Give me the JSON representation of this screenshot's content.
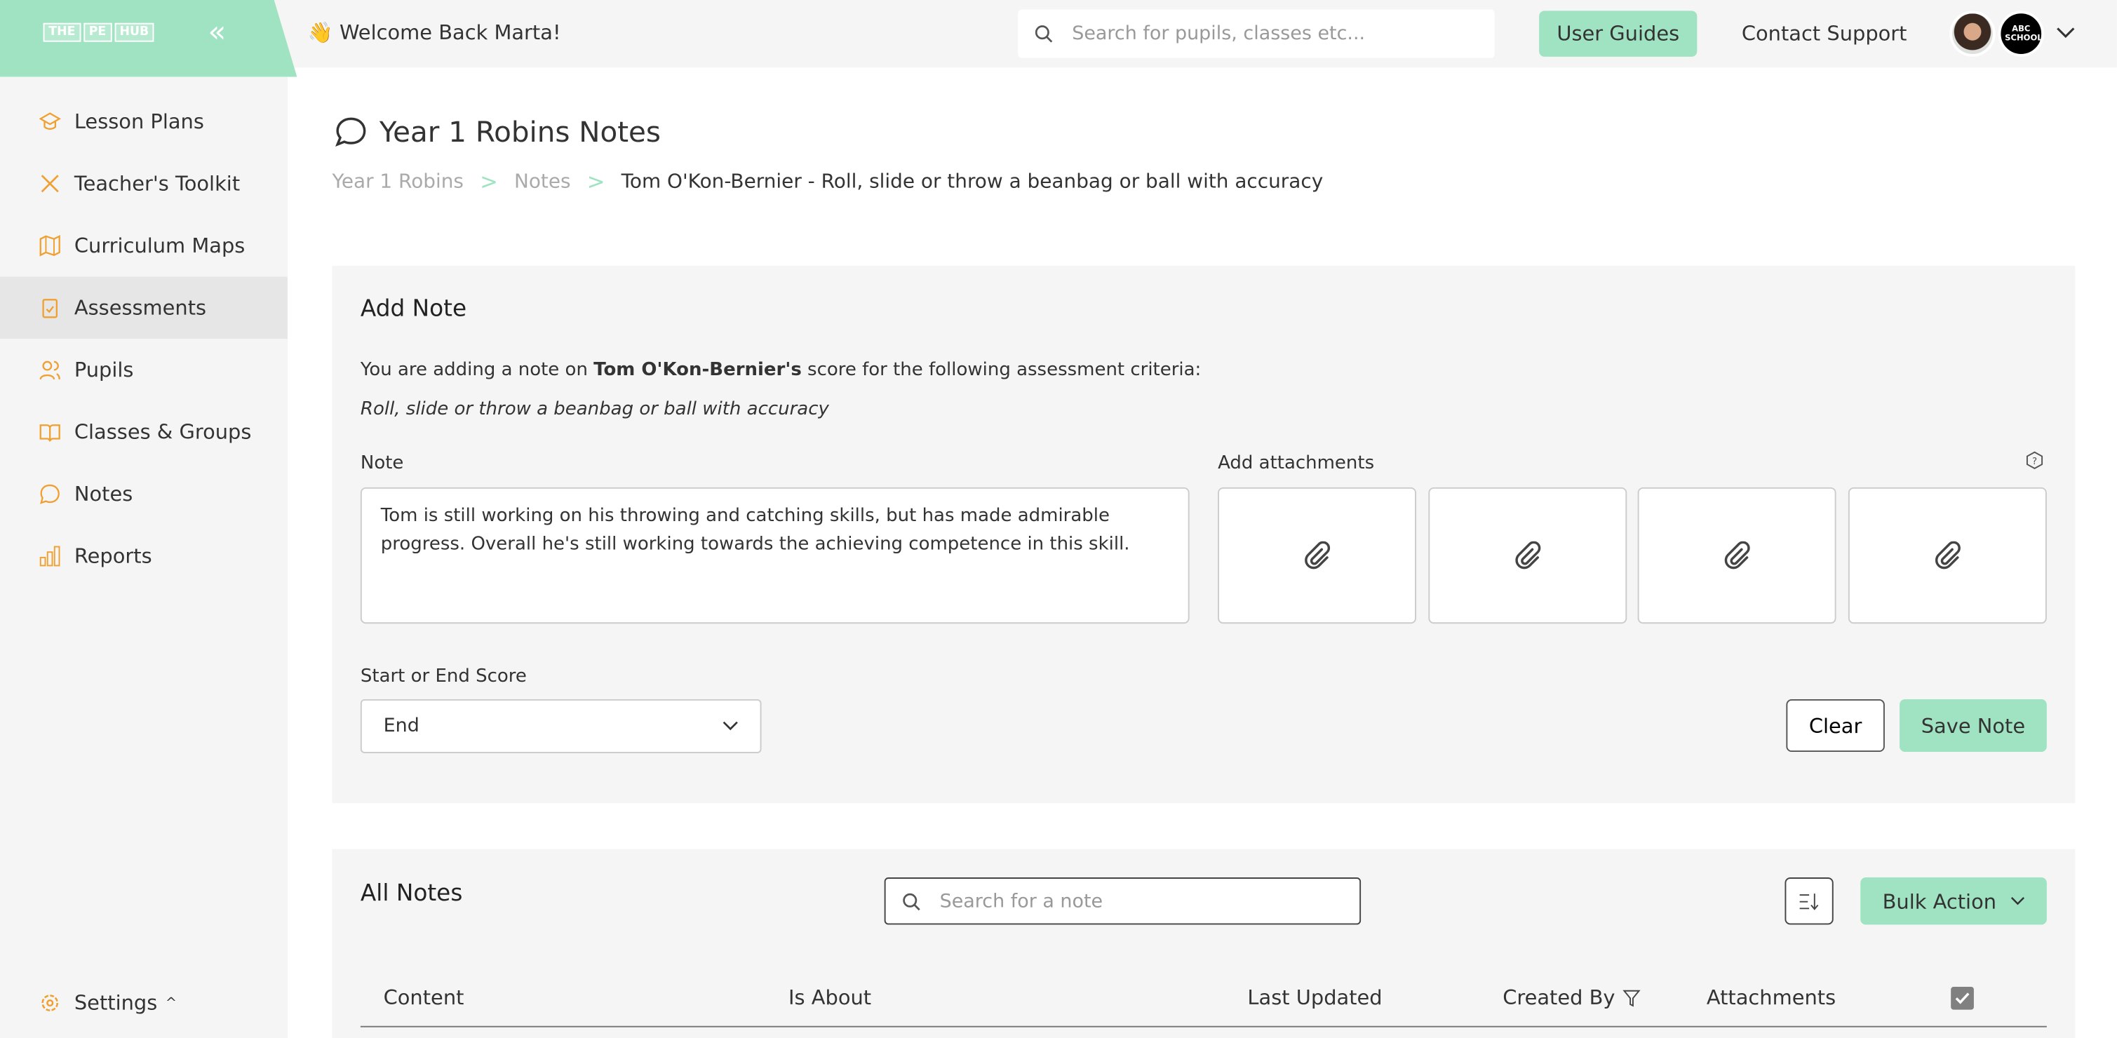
{
  "colors": {
    "accent": "#9fe3c2",
    "icon_orange": "#f0a030",
    "sidebar_bg": "#f5f5f5"
  },
  "logo": {
    "text": "THE PE HUB",
    "parts": [
      "THE",
      "PE",
      "HUB"
    ]
  },
  "header": {
    "welcome": "👋 Welcome Back Marta!",
    "search_placeholder": "Search for pupils, classes etc...",
    "user_guides": "User Guides",
    "contact_support": "Contact Support",
    "school_logo": "ABC SCHOOL"
  },
  "sidebar": {
    "items": [
      {
        "label": "Lesson Plans",
        "icon": "graduation-cap-icon"
      },
      {
        "label": "Teacher's Toolkit",
        "icon": "tools-icon"
      },
      {
        "label": "Curriculum Maps",
        "icon": "map-icon"
      },
      {
        "label": "Assessments",
        "icon": "clipboard-check-icon",
        "active": true
      },
      {
        "label": "Pupils",
        "icon": "users-icon"
      },
      {
        "label": "Classes & Groups",
        "icon": "book-icon"
      },
      {
        "label": "Notes",
        "icon": "chat-icon"
      },
      {
        "label": "Reports",
        "icon": "bar-chart-icon"
      }
    ],
    "settings": "Settings"
  },
  "page": {
    "title": "Year 1 Robins Notes",
    "breadcrumb": [
      "Year 1 Robins",
      "Notes",
      "Tom O'Kon-Bernier - Roll, slide or throw a beanbag or ball with accuracy"
    ]
  },
  "add_note": {
    "heading": "Add Note",
    "intro_pre": "You are adding a note on ",
    "pupil": "Tom O'Kon-Bernier's",
    "intro_post": " score for the following assessment criteria:",
    "criteria": "Roll, slide or throw a beanbag or ball with accuracy",
    "note_label": "Note",
    "note_value": "Tom is still working on his throwing and catching skills, but has made admirable progress. Overall he's still working towards the achieving competence in this skill.",
    "attachments_label": "Add attachments",
    "score_label": "Start or End Score",
    "score_value": "End",
    "clear": "Clear",
    "save": "Save Note"
  },
  "all_notes": {
    "heading": "All Notes",
    "search_placeholder": "Search for a note",
    "bulk_action": "Bulk Action",
    "columns": [
      "Content",
      "Is About",
      "Last Updated",
      "Created By",
      "Attachments"
    ]
  }
}
